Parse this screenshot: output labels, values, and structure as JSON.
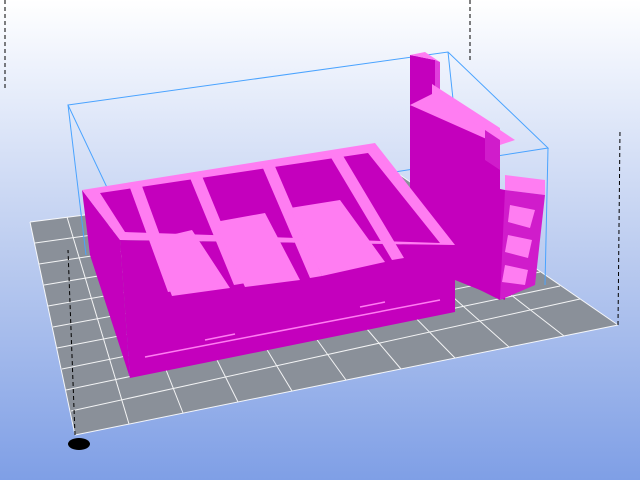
{
  "app": {
    "view": "3d-print-preview"
  },
  "scene": {
    "colors": {
      "background_top": "#ffffff",
      "background_bottom": "#7f9fe6",
      "build_plate": "#8a9099",
      "grid_line": "#ffffff",
      "model_top": "#ff7df2",
      "model_side_dark": "#c400bd",
      "model_side_mid": "#e03ddc",
      "bounding_box": "#4aa3ff",
      "axis_line": "#000000",
      "origin_marker": "#000000"
    },
    "objects": [
      {
        "name": "bed-frame-model"
      },
      {
        "name": "headboard-shelf-model"
      }
    ]
  }
}
